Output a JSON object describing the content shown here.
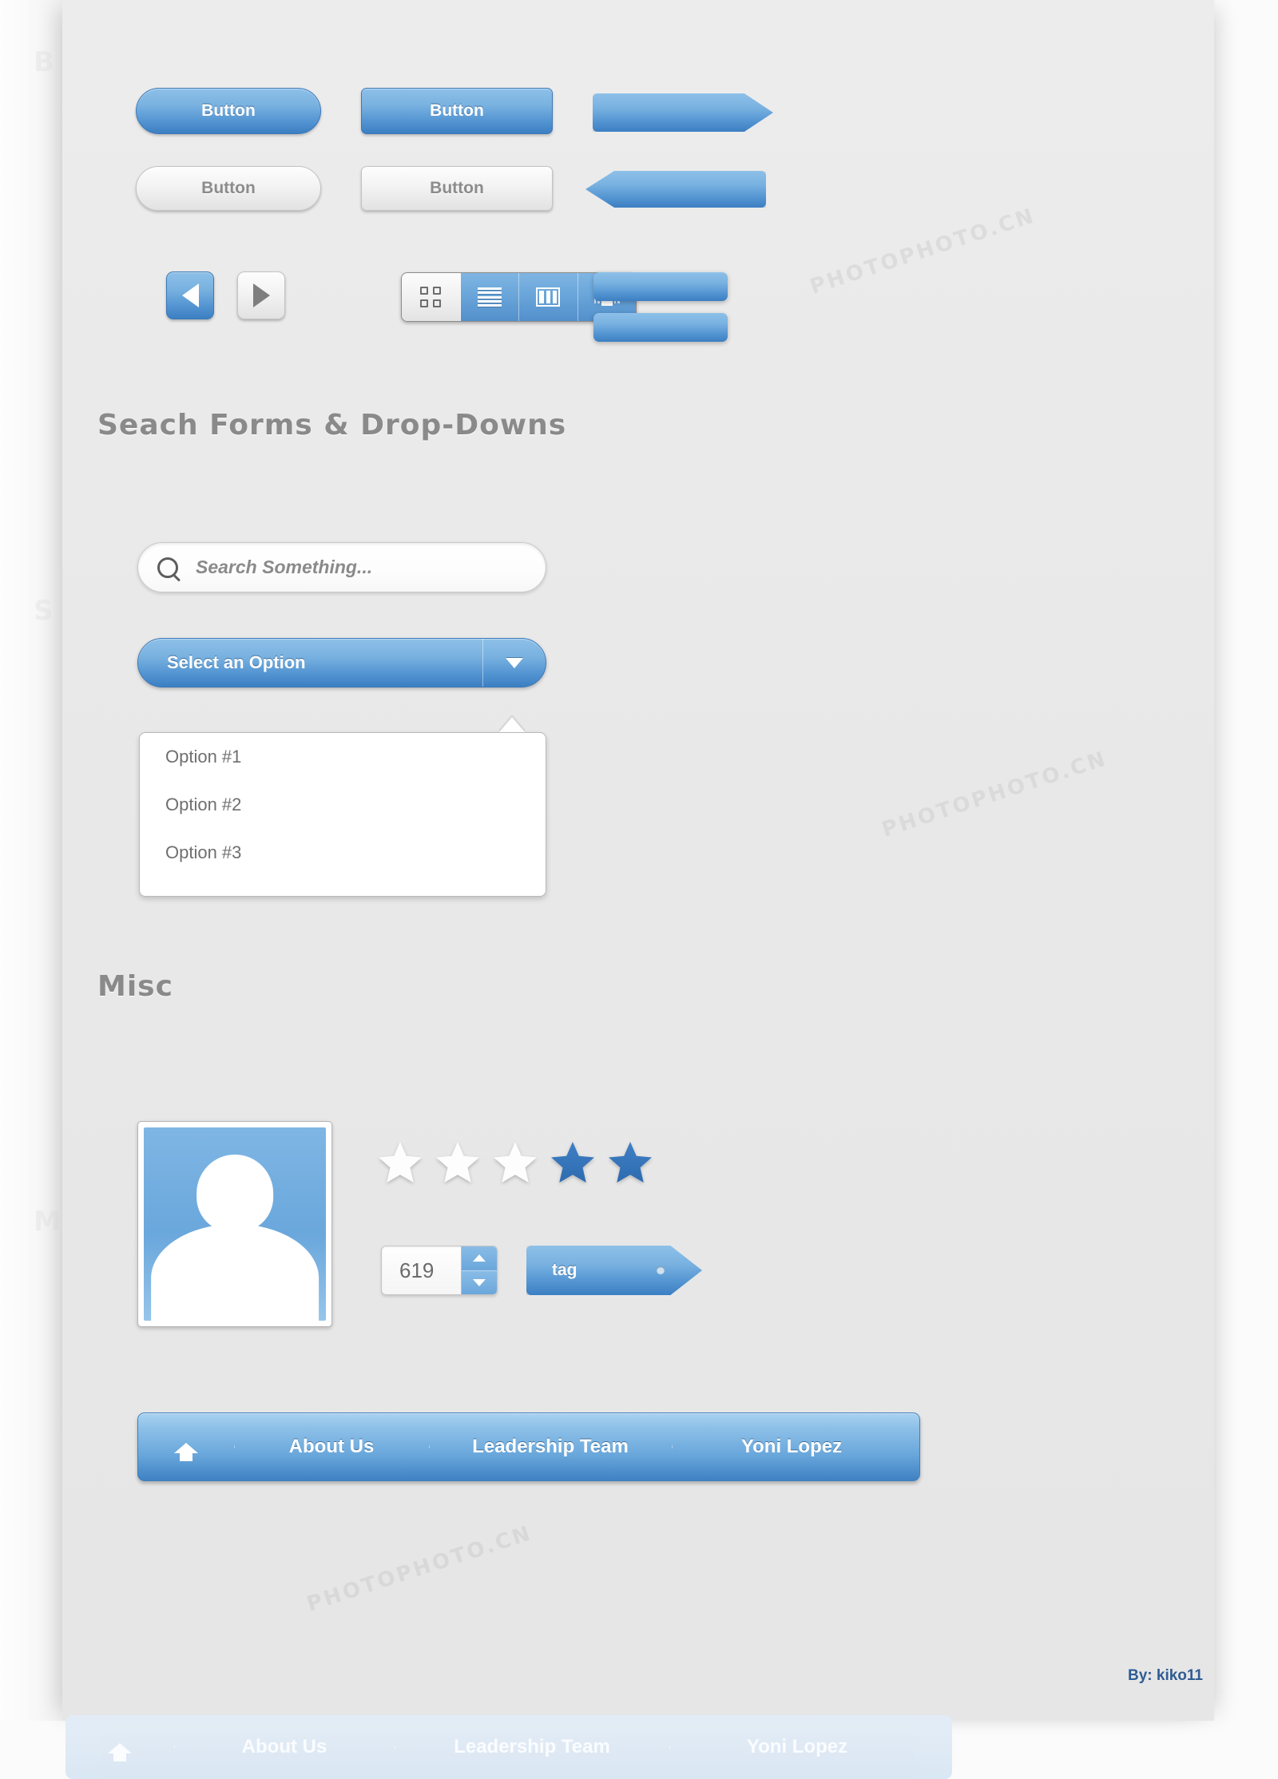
{
  "meta": {
    "credit": "By: kiko11",
    "watermark": "PHOTOPHOTO.CN"
  },
  "ghost_headings": [
    "B",
    "S",
    "M"
  ],
  "buttons": {
    "primary_pill": "Button",
    "primary_rect": "Button",
    "disabled_pill": "Button",
    "disabled_rect": "Button",
    "arrow_right_label": "",
    "arrow_left_label": "",
    "bar_one_label": "",
    "bar_two_label": ""
  },
  "icon_buttons": {
    "prev": "prev-triangle",
    "next": "next-triangle"
  },
  "segmented": {
    "items": [
      {
        "name": "grid-view",
        "active": true
      },
      {
        "name": "list-view",
        "active": false
      },
      {
        "name": "column-view",
        "active": false
      },
      {
        "name": "gallery-view",
        "active": false
      }
    ]
  },
  "sections": {
    "forms_heading": "Seach Forms & Drop-Downs",
    "misc_heading": "Misc"
  },
  "search": {
    "placeholder": "Search Something...",
    "value": "",
    "icon": "search-icon"
  },
  "select": {
    "label": "Select an Option",
    "caret": "chevron-down-icon",
    "options": [
      "Option #1",
      "Option #2",
      "Option #3"
    ]
  },
  "misc": {
    "avatar_alt": "avatar-placeholder",
    "rating": {
      "total": 5,
      "filled": 2,
      "empty": 3
    },
    "stepper": {
      "value": "619"
    },
    "tag": {
      "label": "tag"
    }
  },
  "breadcrumb": {
    "home_icon": "home-icon",
    "items": [
      "About Us",
      "Leadership Team",
      "Yoni Lopez"
    ]
  },
  "colors": {
    "blue_light": "#8dc0e8",
    "blue_mid": "#5495d2",
    "blue_dark": "#3c7fc2",
    "panel_grey": "#e8e8e8",
    "text_grey": "#8a8a8a",
    "credit_blue": "#2f5c93"
  }
}
